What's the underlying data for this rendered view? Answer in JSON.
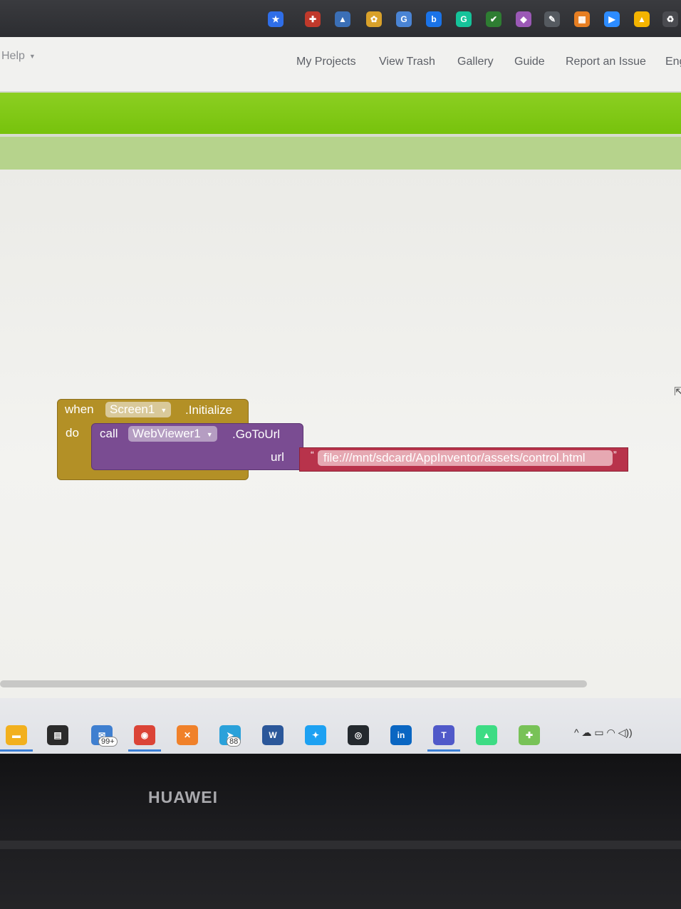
{
  "header": {
    "help_label": "Help",
    "nav_links": [
      "My Projects",
      "View Trash",
      "Gallery",
      "Guide",
      "Report an Issue",
      "Eng"
    ]
  },
  "extensions": [
    {
      "icon": "star-bookmark-icon",
      "glyph": "★",
      "color": "#2f6ee8"
    },
    {
      "icon": "shield-crest-icon",
      "glyph": "✚",
      "color": "#c0392b"
    },
    {
      "icon": "building-icon",
      "glyph": "▲",
      "color": "#3b6fb6"
    },
    {
      "icon": "puzzle-icon",
      "glyph": "✿",
      "color": "#d9a12a"
    },
    {
      "icon": "google-translate-icon",
      "glyph": "G",
      "color": "#4a84d4"
    },
    {
      "icon": "b-extension-icon",
      "glyph": "b",
      "color": "#1a73e8"
    },
    {
      "icon": "grammarly-icon",
      "glyph": "G",
      "color": "#15c39a"
    },
    {
      "icon": "checkmark-icon",
      "glyph": "✔",
      "color": "#2e7d32"
    },
    {
      "icon": "feather-icon",
      "glyph": "◆",
      "color": "#9b59b6"
    },
    {
      "icon": "pen-icon",
      "glyph": "✎",
      "color": "#555a60"
    },
    {
      "icon": "color-grid-icon",
      "glyph": "▦",
      "color": "#e67e22"
    },
    {
      "icon": "zoom-icon",
      "glyph": "▶",
      "color": "#2d8cff"
    },
    {
      "icon": "google-drive-icon",
      "glyph": "▲",
      "color": "#f4b400"
    },
    {
      "icon": "recycle-icon",
      "glyph": "♻",
      "color": "#4a4b50"
    }
  ],
  "blocks": {
    "event": {
      "when_label": "when",
      "component": "Screen1",
      "event_name": ".Initialize",
      "do_label": "do"
    },
    "call": {
      "call_label": "call",
      "component": "WebViewer1",
      "method": ".GoToUrl",
      "param_label": "url"
    },
    "text": {
      "open_quote": "“",
      "value": "file:///mnt/sdcard/AppInventor/assets/control.html",
      "close_quote": "”"
    }
  },
  "taskbar": {
    "apps": [
      {
        "icon": "file-explorer-icon",
        "glyph": "▬",
        "color": "#f2b01e",
        "active": true
      },
      {
        "icon": "microsoft-store-icon",
        "glyph": "▤",
        "color": "#2b2b2b",
        "active": false
      },
      {
        "icon": "mail-icon",
        "glyph": "✉",
        "color": "#3f7fd0",
        "active": false,
        "badge": "99+"
      },
      {
        "icon": "chrome-icon",
        "glyph": "◉",
        "color": "#db4437",
        "active": true
      },
      {
        "icon": "xampp-icon",
        "glyph": "✕",
        "color": "#f0812a",
        "active": false
      },
      {
        "icon": "telegram-icon",
        "glyph": "➤",
        "color": "#2aa1da",
        "active": false,
        "badge": "88"
      },
      {
        "icon": "word-icon",
        "glyph": "W",
        "color": "#2b579a",
        "active": false
      },
      {
        "icon": "twitter-icon",
        "glyph": "✦",
        "color": "#1da1f2",
        "active": false
      },
      {
        "icon": "github-icon",
        "glyph": "◎",
        "color": "#24292e",
        "active": false
      },
      {
        "icon": "linkedin-icon",
        "glyph": "in",
        "color": "#0a66c2",
        "active": false
      },
      {
        "icon": "teams-icon",
        "glyph": "T",
        "color": "#5059c9",
        "active": true
      },
      {
        "icon": "android-studio-icon",
        "glyph": "▲",
        "color": "#3ddc84",
        "active": false
      },
      {
        "icon": "android-icon",
        "glyph": "✚",
        "color": "#78c257",
        "active": false
      }
    ],
    "tray_text": "^ ☁ ▭ ◠ ◁))"
  },
  "bezel": {
    "brand": "HUAWEI"
  }
}
